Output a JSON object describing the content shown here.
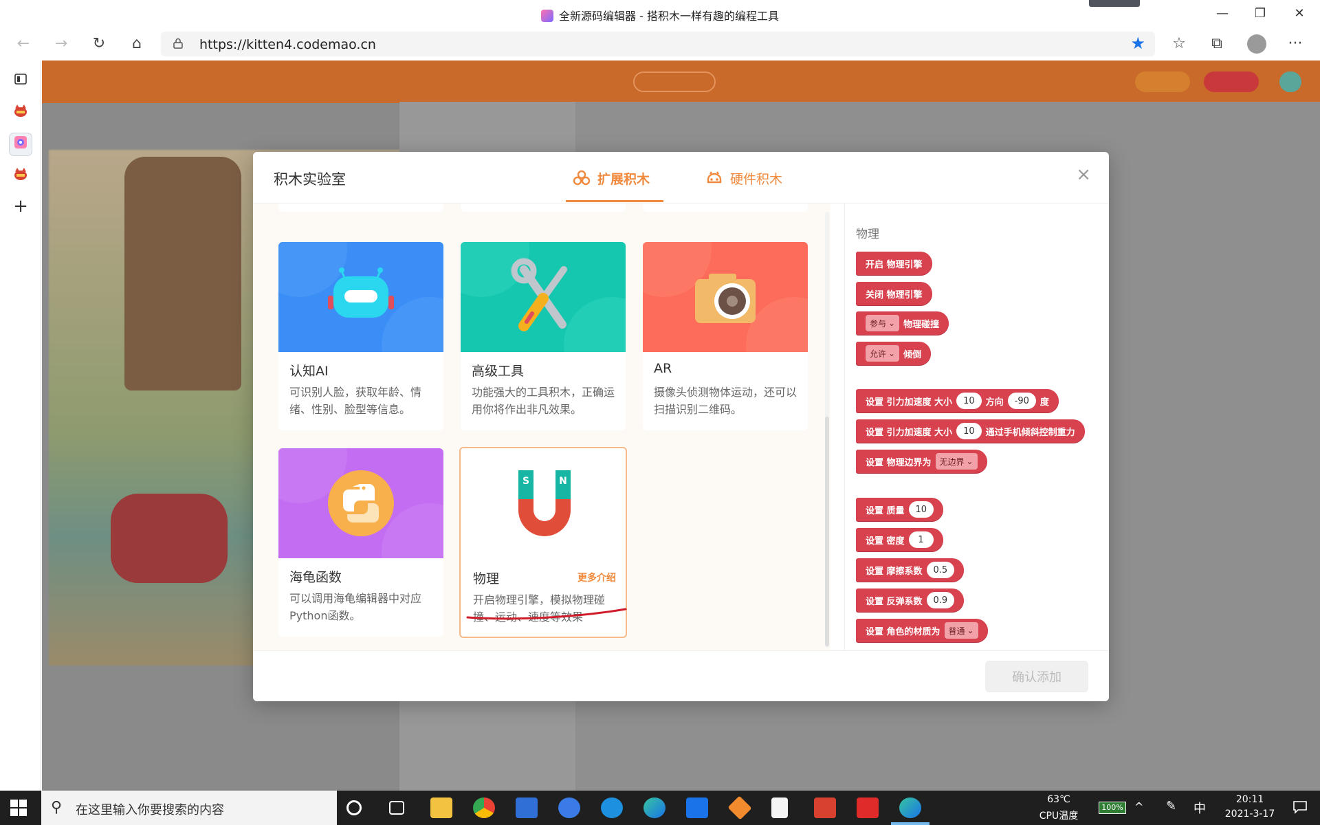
{
  "window": {
    "title": "全新源码编辑器 - 搭积木一样有趣的编程工具",
    "minimize": "—",
    "maximize": "❐",
    "close": "✕"
  },
  "browser": {
    "url": "https://kitten4.codemao.cn",
    "back": "←",
    "forward": "→",
    "reload": "↻",
    "home": "⌂",
    "favorite": "★",
    "favorites_list": "☆",
    "collections": "⧉",
    "more": "···"
  },
  "sidebar": {
    "new_tab": "+"
  },
  "modal": {
    "title": "积木实验室",
    "close": "×",
    "tabs": [
      {
        "label": "扩展积木",
        "active": true
      },
      {
        "label": "硬件积木",
        "active": false
      }
    ],
    "cards": [
      {
        "title": "认知AI",
        "desc": "可识别人脸，获取年龄、情绪、性别、脸型等信息。",
        "color": "#3a8ef6"
      },
      {
        "title": "高级工具",
        "desc": "功能强大的工具积木，正确运用你将作出非凡效果。",
        "color": "#16c7b0"
      },
      {
        "title": "AR",
        "desc": "摄像头侦测物体运动，还可以扫描识别二维码。",
        "color": "#fd6c5a"
      },
      {
        "title": "海龟函数",
        "desc": "可以调用海龟编辑器中对应Python函数。",
        "color": "#c36ef2"
      },
      {
        "title": "物理",
        "desc": "开启物理引擎，模拟物理碰撞、运动、速度等效果",
        "more": "更多介绍",
        "selected": true
      }
    ],
    "blocks_heading": "物理",
    "blocks": {
      "b1": "开启 物理引擎",
      "b2": "关闭 物理引擎",
      "b3_dd": "参与",
      "b3": "物理碰撞",
      "b4_dd": "允许",
      "b4": "倾倒",
      "b5_a": "设置 引力加速度 大小",
      "b5_v1": "10",
      "b5_b": "方向",
      "b5_v2": "-90",
      "b5_c": "度",
      "b6_a": "设置 引力加速度 大小",
      "b6_v1": "10",
      "b6_b": "通过手机倾斜控制重力",
      "b7_a": "设置 物理边界为",
      "b7_dd": "无边界",
      "b8_a": "设置 质量",
      "b8_v": "10",
      "b9_a": "设置 密度",
      "b9_v": "1",
      "b10_a": "设置 摩擦系数",
      "b10_v": "0.5",
      "b11_a": "设置 反弹系数",
      "b11_v": "0.9",
      "b12_a": "设置 角色的材质为",
      "b12_dd": "普通"
    },
    "confirm": "确认添加"
  },
  "magnet": {
    "s": "S",
    "n": "N"
  },
  "taskbar": {
    "search_placeholder": "在这里输入你要搜索的内容",
    "temp": "63℃",
    "temp_label": "CPU温度",
    "battery": "100%",
    "ime": "中",
    "time": "20:11",
    "date": "2021-3-17"
  }
}
